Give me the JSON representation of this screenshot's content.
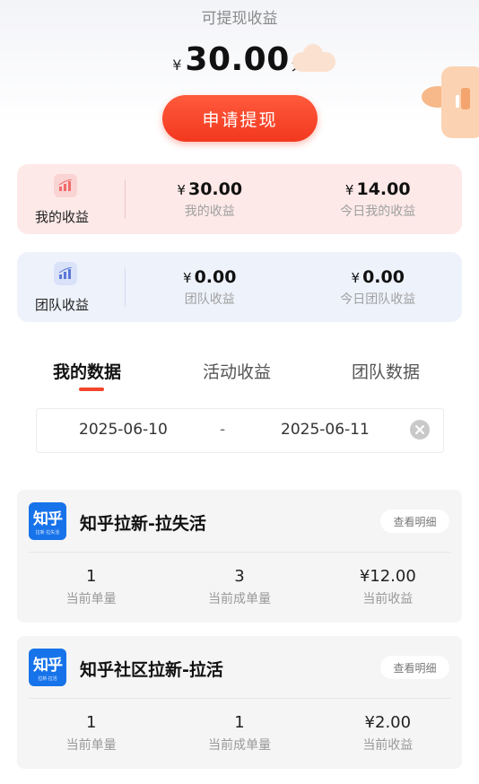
{
  "header": {
    "title": "可提现收益",
    "currency_symbol": "¥",
    "amount": "30.00",
    "unit": "元",
    "withdraw_label": "申请提现"
  },
  "my_earnings": {
    "label": "我的收益",
    "items": [
      {
        "currency": "¥",
        "value": "30.00",
        "label": "我的收益"
      },
      {
        "currency": "¥",
        "value": "14.00",
        "label": "今日我的收益"
      }
    ]
  },
  "team_earnings": {
    "label": "团队收益",
    "items": [
      {
        "currency": "¥",
        "value": "0.00",
        "label": "团队收益"
      },
      {
        "currency": "¥",
        "value": "0.00",
        "label": "今日团队收益"
      }
    ]
  },
  "tabs": [
    {
      "label": "我的数据",
      "active": true
    },
    {
      "label": "活动收益",
      "active": false
    },
    {
      "label": "团队数据",
      "active": false
    }
  ],
  "date_range": {
    "start": "2025-06-10",
    "separator": "-",
    "end": "2025-06-11"
  },
  "tasks": [
    {
      "logo_text": "知乎",
      "logo_sub": "拉新·拉失活",
      "title": "知乎拉新-拉失活",
      "detail_label": "查看明细",
      "metrics": [
        {
          "value": "1",
          "label": "当前单量"
        },
        {
          "value": "3",
          "label": "当前成单量"
        },
        {
          "value": "¥12.00",
          "label": "当前收益"
        }
      ]
    },
    {
      "logo_text": "知乎",
      "logo_sub": "拉新·拉活",
      "title": "知乎社区拉新-拉活",
      "detail_label": "查看明细",
      "metrics": [
        {
          "value": "1",
          "label": "当前单量"
        },
        {
          "value": "1",
          "label": "当前成单量"
        },
        {
          "value": "¥2.00",
          "label": "当前收益"
        }
      ]
    }
  ],
  "colors": {
    "accent": "#f2452b",
    "brand_zhihu": "#1773ea",
    "my_card_bg": "#fde9e8",
    "team_card_bg": "#eef2fb"
  },
  "icons": {
    "my_earnings": "bar-chart-icon",
    "team_earnings": "bar-chart-icon",
    "clear": "clear-icon"
  }
}
